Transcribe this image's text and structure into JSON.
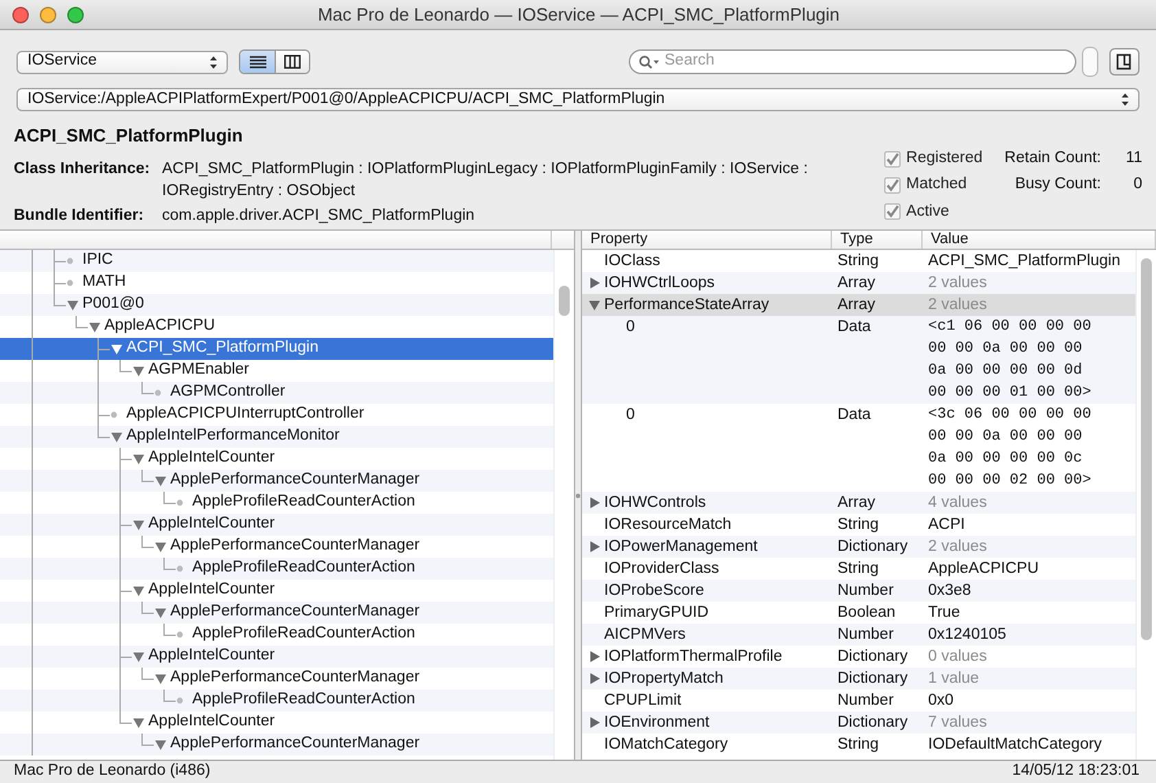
{
  "window": {
    "title": "Mac Pro de Leonardo — IOService — ACPI_SMC_PlatformPlugin"
  },
  "toolbar": {
    "plane": "IOService",
    "view_modes": [
      {
        "kind": "list",
        "selected": true
      },
      {
        "kind": "columns",
        "selected": false
      }
    ],
    "search": {
      "placeholder": "Search"
    }
  },
  "path": "IOService:/AppleACPIPlatformExpert/P001@0/AppleACPICPU/ACPI_SMC_PlatformPlugin",
  "details": {
    "name": "ACPI_SMC_PlatformPlugin",
    "fields": [
      {
        "label": "Class Inheritance:",
        "value": "ACPI_SMC_PlatformPlugin : IOPlatformPluginLegacy : IOPlatformPluginFamily : IOService : IORegistryEntry : OSObject"
      },
      {
        "label": "Bundle Identifier:",
        "value": "com.apple.driver.ACPI_SMC_PlatformPlugin"
      }
    ],
    "flags": [
      {
        "label": "Registered",
        "checked": true
      },
      {
        "label": "Matched",
        "checked": true
      },
      {
        "label": "Active",
        "checked": true
      }
    ],
    "counts": [
      {
        "label": "Retain Count:",
        "value": "11"
      },
      {
        "label": "Busy Count:",
        "value": "0"
      }
    ]
  },
  "tree": {
    "items": [
      {
        "label": "IPIC",
        "kind": "leaf",
        "selected": false
      },
      {
        "label": "MATH",
        "kind": "leaf",
        "selected": false
      },
      {
        "label": "P001@0",
        "kind": "branch",
        "expanded": true,
        "selected": false,
        "children": [
          {
            "label": "AppleACPICPU",
            "kind": "branch",
            "expanded": true,
            "selected": false,
            "children": [
              {
                "label": "ACPI_SMC_PlatformPlugin",
                "kind": "branch",
                "expanded": true,
                "selected": true,
                "children": [
                  {
                    "label": "AGPMEnabler",
                    "kind": "branch",
                    "expanded": true,
                    "selected": false,
                    "children": [
                      {
                        "label": "AGPMController",
                        "kind": "leaf",
                        "selected": false
                      }
                    ]
                  }
                ]
              },
              {
                "label": "AppleACPICPUInterruptController",
                "kind": "leaf",
                "selected": false
              },
              {
                "label": "AppleIntelPerformanceMonitor",
                "kind": "branch",
                "expanded": true,
                "selected": false,
                "children": [
                  {
                    "label": "AppleIntelCounter",
                    "kind": "branch",
                    "expanded": true,
                    "selected": false,
                    "children": [
                      {
                        "label": "ApplePerformanceCounterManager",
                        "kind": "branch",
                        "expanded": true,
                        "selected": false,
                        "children": [
                          {
                            "label": "AppleProfileReadCounterAction",
                            "kind": "leaf",
                            "selected": false
                          }
                        ]
                      }
                    ]
                  },
                  {
                    "label": "AppleIntelCounter",
                    "kind": "branch",
                    "expanded": true,
                    "selected": false,
                    "children": [
                      {
                        "label": "ApplePerformanceCounterManager",
                        "kind": "branch",
                        "expanded": true,
                        "selected": false,
                        "children": [
                          {
                            "label": "AppleProfileReadCounterAction",
                            "kind": "leaf",
                            "selected": false
                          }
                        ]
                      }
                    ]
                  },
                  {
                    "label": "AppleIntelCounter",
                    "kind": "branch",
                    "expanded": true,
                    "selected": false,
                    "children": [
                      {
                        "label": "ApplePerformanceCounterManager",
                        "kind": "branch",
                        "expanded": true,
                        "selected": false,
                        "children": [
                          {
                            "label": "AppleProfileReadCounterAction",
                            "kind": "leaf",
                            "selected": false
                          }
                        ]
                      }
                    ]
                  },
                  {
                    "label": "AppleIntelCounter",
                    "kind": "branch",
                    "expanded": true,
                    "selected": false,
                    "children": [
                      {
                        "label": "ApplePerformanceCounterManager",
                        "kind": "branch",
                        "expanded": true,
                        "selected": false,
                        "children": [
                          {
                            "label": "AppleProfileReadCounterAction",
                            "kind": "leaf",
                            "selected": false
                          }
                        ]
                      }
                    ]
                  },
                  {
                    "label": "AppleIntelCounter",
                    "kind": "branch",
                    "expanded": true,
                    "selected": false,
                    "children": [
                      {
                        "label": "ApplePerformanceCounterManager",
                        "kind": "branch",
                        "expanded": true,
                        "selected": false
                      }
                    ]
                  }
                ]
              }
            ]
          }
        ]
      }
    ]
  },
  "properties": {
    "columns": [
      "Property",
      "Type",
      "Value"
    ],
    "rows": [
      {
        "name": "IOClass",
        "type": "String",
        "value": "ACPI_SMC_PlatformPlugin",
        "kind": "leaf",
        "selected": false
      },
      {
        "name": "IOHWCtrlLoops",
        "type": "Array",
        "value": "2 values",
        "kind": "collection",
        "expanded": false,
        "selected": false
      },
      {
        "name": "PerformanceStateArray",
        "type": "Array",
        "value": "2 values",
        "kind": "collection",
        "expanded": true,
        "selected": true,
        "children": [
          {
            "name": "0",
            "type": "Data",
            "value": "<c1 06 00 00 00 00 00 00 0a 00 00 00 0a 00 00 00 00 0d 00 00 00 01 00 00>",
            "kind": "data",
            "selected": false
          },
          {
            "name": "0",
            "type": "Data",
            "value": "<3c 06 00 00 00 00 00 00 0a 00 00 00 0a 00 00 00 00 0c 00 00 00 02 00 00>",
            "kind": "data",
            "selected": false
          }
        ]
      },
      {
        "name": "IOHWControls",
        "type": "Array",
        "value": "4 values",
        "kind": "collection",
        "expanded": false,
        "selected": false
      },
      {
        "name": "IOResourceMatch",
        "type": "String",
        "value": "ACPI",
        "kind": "leaf",
        "selected": false
      },
      {
        "name": "IOPowerManagement",
        "type": "Dictionary",
        "value": "2 values",
        "kind": "collection",
        "expanded": false,
        "selected": false
      },
      {
        "name": "IOProviderClass",
        "type": "String",
        "value": "AppleACPICPU",
        "kind": "leaf",
        "selected": false
      },
      {
        "name": "IOProbeScore",
        "type": "Number",
        "value": "0x3e8",
        "kind": "leaf",
        "selected": false
      },
      {
        "name": "PrimaryGPUID",
        "type": "Boolean",
        "value": "True",
        "kind": "leaf",
        "selected": false
      },
      {
        "name": "AICPMVers",
        "type": "Number",
        "value": "0x1240105",
        "kind": "leaf",
        "selected": false
      },
      {
        "name": "IOPlatformThermalProfile",
        "type": "Dictionary",
        "value": "0 values",
        "kind": "collection",
        "expanded": false,
        "selected": false
      },
      {
        "name": "IOPropertyMatch",
        "type": "Dictionary",
        "value": "1 value",
        "kind": "collection",
        "expanded": false,
        "selected": false
      },
      {
        "name": "CPUPLimit",
        "type": "Number",
        "value": "0x0",
        "kind": "leaf",
        "selected": false
      },
      {
        "name": "IOEnvironment",
        "type": "Dictionary",
        "value": "7 values",
        "kind": "collection",
        "expanded": false,
        "selected": false
      },
      {
        "name": "IOMatchCategory",
        "type": "String",
        "value": "IODefaultMatchCategory",
        "kind": "leaf",
        "selected": false
      }
    ]
  },
  "status_bar": {
    "machine": "Mac Pro de Leonardo (i486)",
    "timestamp": "14/05/12 18:23:01"
  }
}
